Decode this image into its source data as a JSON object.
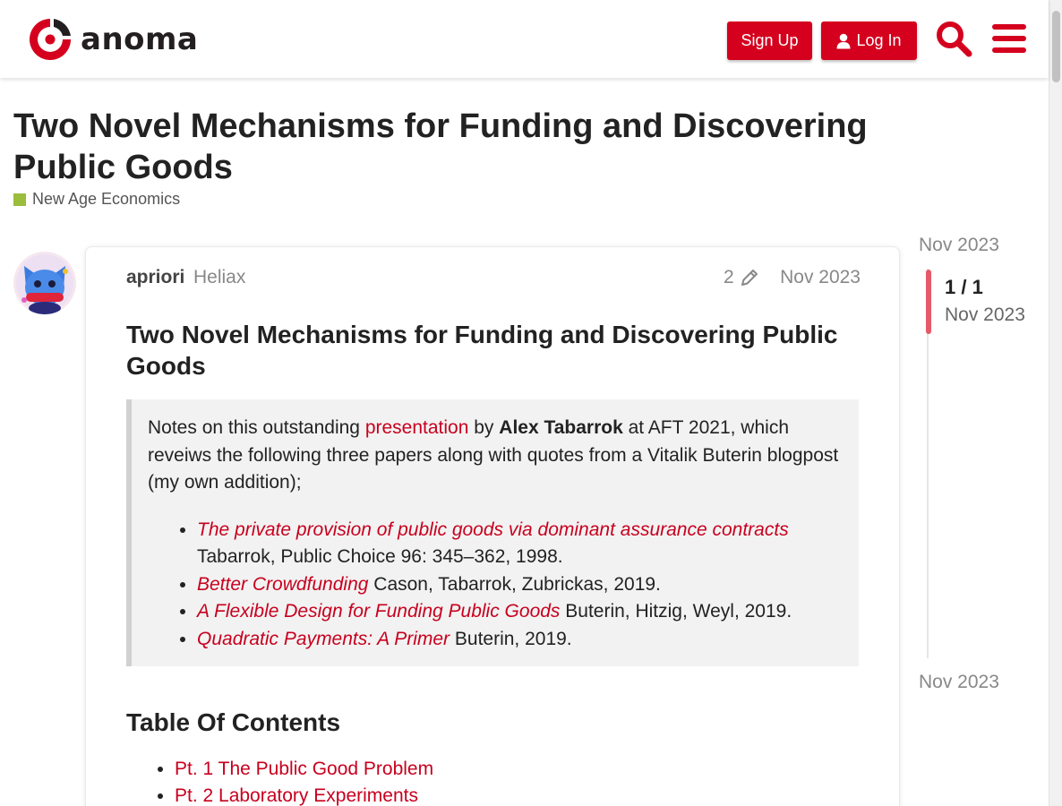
{
  "header": {
    "logo_text": "anoma",
    "signup_label": "Sign Up",
    "login_label": "Log In",
    "search_icon": "search-icon",
    "menu_icon": "hamburger-menu-icon",
    "accent_color": "#d4001e"
  },
  "topic": {
    "title": "Two Novel Mechanisms for Funding and Discovering Public Goods",
    "category": "New Age Economics",
    "category_color": "#9bbd3c"
  },
  "post": {
    "username": "apriori",
    "user_title": "Heliax",
    "edit_count": "2",
    "date": "Nov 2023",
    "heading": "Two Novel Mechanisms for Funding and Discovering Public Goods",
    "intro": {
      "before": "Notes on this outstanding ",
      "link": "presentation",
      "by": " by ",
      "author": "Alex Tabarrok",
      "after": " at AFT 2021, which reveiws the following three papers along with quotes from a Vitalik Buterin blogpost (my own addition);"
    },
    "papers": [
      {
        "title": "The private provision of public goods via dominant assurance contracts",
        "citation": "Tabarrok, Public Choice 96: 345–362, 1998."
      },
      {
        "title": "Better Crowdfunding",
        "citation": " Cason, Tabarrok, Zubrickas, 2019."
      },
      {
        "title": "A Flexible Design for Funding Public Goods",
        "citation": " Buterin, Hitzig, Weyl, 2019."
      },
      {
        "title": "Quadratic Payments: A Primer",
        "citation": " Buterin, 2019."
      }
    ],
    "toc_heading": "Table Of Contents",
    "toc": [
      "Pt. 1 The Public Good Problem",
      "Pt. 2 Laboratory Experiments"
    ]
  },
  "timeline": {
    "start": "Nov 2023",
    "position": "1 / 1",
    "current_date": "Nov 2023",
    "end": "Nov 2023"
  }
}
